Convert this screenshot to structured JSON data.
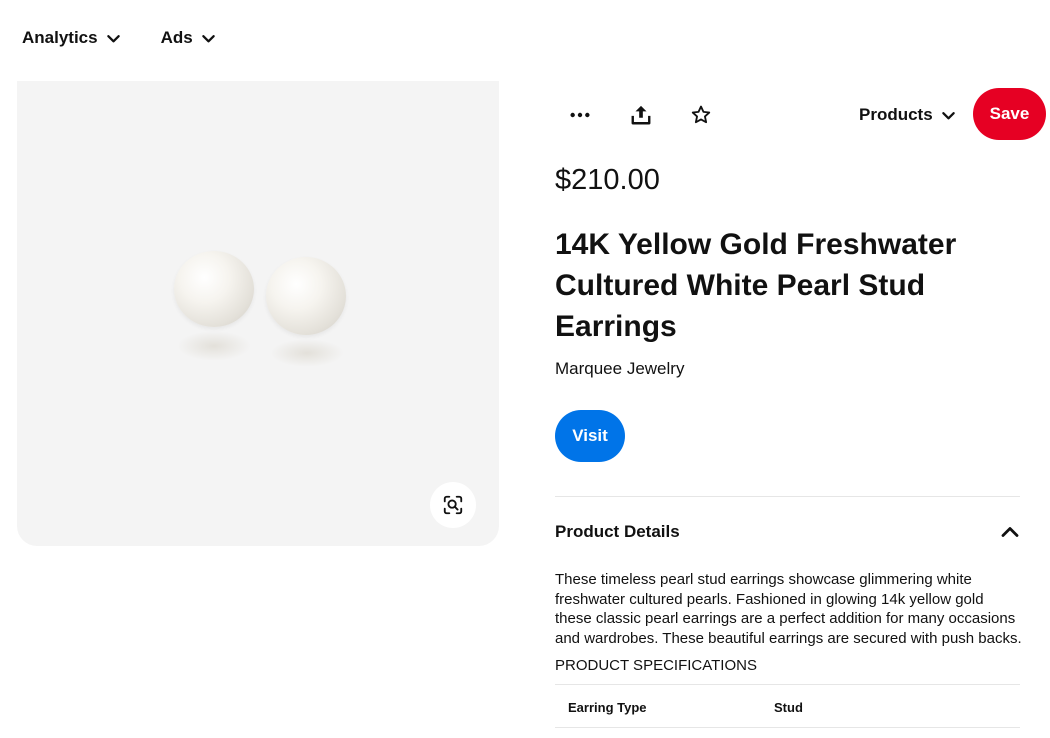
{
  "nav": {
    "items": [
      {
        "label": "Analytics"
      },
      {
        "label": "Ads"
      }
    ]
  },
  "actions": {
    "more_icon": "more-horizontal-icon",
    "share_icon": "share-upload-icon",
    "favorite_icon": "star-outline-icon",
    "products_label": "Products",
    "save_label": "Save"
  },
  "product": {
    "price": "$210.00",
    "title": "14K Yellow Gold Freshwater Cultured White Pearl Stud Earrings",
    "merchant": "Marquee Jewelry",
    "visit_label": "Visit",
    "details_title": "Product Details",
    "description": "These timeless pearl stud earrings showcase glimmering white freshwater cultured pearls. Fashioned in glowing 14k yellow gold these classic pearl earrings are a perfect addition for many occasions and wardrobes. These beautiful earrings are secured with push backs.",
    "specs_label": "PRODUCT SPECIFICATIONS",
    "specs": [
      {
        "key": "Earring Type",
        "value": "Stud"
      }
    ]
  },
  "colors": {
    "save": "#e60023",
    "visit": "#0074e8",
    "image_bg": "#f4f4f4"
  }
}
